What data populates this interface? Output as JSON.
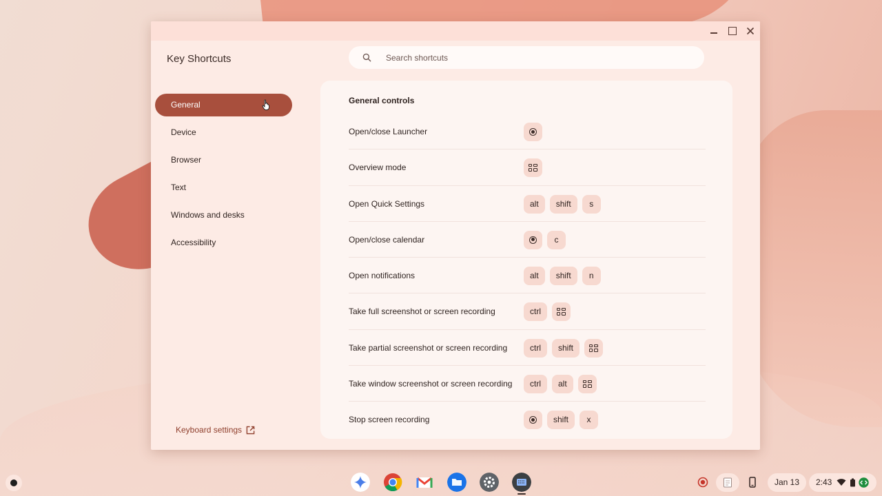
{
  "window": {
    "title": "Key Shortcuts"
  },
  "search": {
    "placeholder": "Search shortcuts"
  },
  "nav": {
    "items": [
      {
        "label": "General"
      },
      {
        "label": "Device"
      },
      {
        "label": "Browser"
      },
      {
        "label": "Text"
      },
      {
        "label": "Windows and desks"
      },
      {
        "label": "Accessibility"
      }
    ],
    "keyboard_settings": "Keyboard settings"
  },
  "panel": {
    "title": "General controls",
    "rows": [
      {
        "label": "Open/close Launcher",
        "keys": [
          "[launcher]"
        ]
      },
      {
        "label": "Overview mode",
        "keys": [
          "[overview]"
        ]
      },
      {
        "label": "Open Quick Settings",
        "keys": [
          "alt",
          "shift",
          "s"
        ]
      },
      {
        "label": "Open/close calendar",
        "keys": [
          "[launcher]",
          "c"
        ]
      },
      {
        "label": "Open notifications",
        "keys": [
          "alt",
          "shift",
          "n"
        ]
      },
      {
        "label": "Take full screenshot or screen recording",
        "keys": [
          "ctrl",
          "[overview]"
        ]
      },
      {
        "label": "Take partial screenshot or screen recording",
        "keys": [
          "ctrl",
          "shift",
          "[overview]"
        ]
      },
      {
        "label": "Take window screenshot or screen recording",
        "keys": [
          "ctrl",
          "alt",
          "[overview]"
        ]
      },
      {
        "label": "Stop screen recording",
        "keys": [
          "[launcher]",
          "shift",
          "x"
        ]
      }
    ]
  },
  "shelf": {
    "date": "Jan 13",
    "time": "2:43",
    "apps": [
      "gemini-icon",
      "chrome-icon",
      "gmail-icon",
      "files-icon",
      "settings-icon",
      "shortcuts-app-icon"
    ]
  },
  "colors": {
    "accent": "#a84f3d",
    "key_bg": "#f7d9d0"
  }
}
